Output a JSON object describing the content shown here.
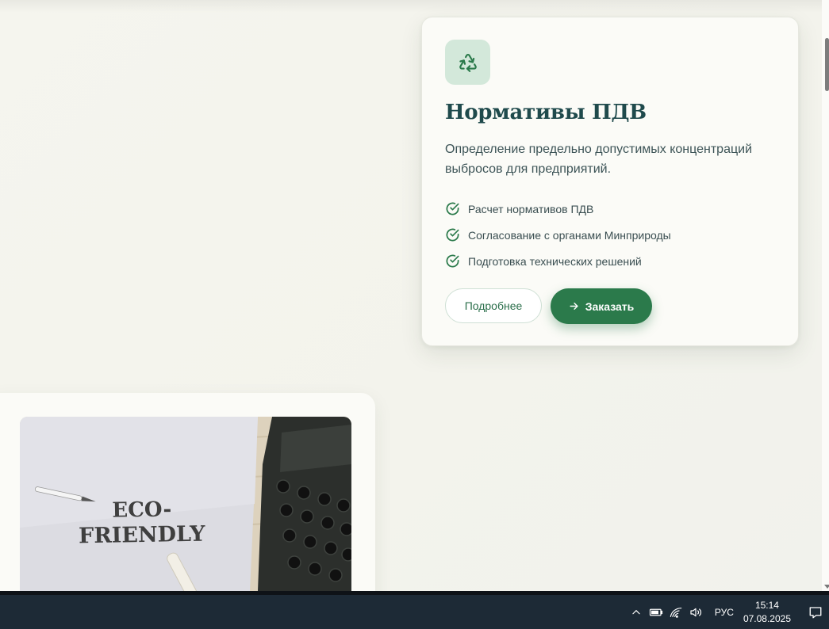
{
  "service_card": {
    "title": "Нормативы ПДВ",
    "description": "Определение предельно допустимых концентраций выбросов для предприятий.",
    "icon": "recycle-icon",
    "features": [
      "Расчет нормативов ПДВ",
      "Согласование с органами Минприроды",
      "Подготовка технических решений"
    ],
    "more_label": "Подробнее",
    "order_label": "Заказать"
  },
  "eco_card": {
    "image_text_line1": "ECO-",
    "image_text_line2": "FRIENDLY"
  },
  "taskbar": {
    "language": "РУС",
    "time": "15:14",
    "date": "07.08.2025",
    "tray_icons": [
      "chevron-up-icon",
      "battery-icon",
      "wifi-icon",
      "volume-icon"
    ]
  },
  "colors": {
    "accent": "#2b7a4b",
    "title": "#1f4a4c",
    "icon_bg": "#d3e8da",
    "page_bg": "#f4f3ec",
    "taskbar_bg": "#1d2a36"
  }
}
